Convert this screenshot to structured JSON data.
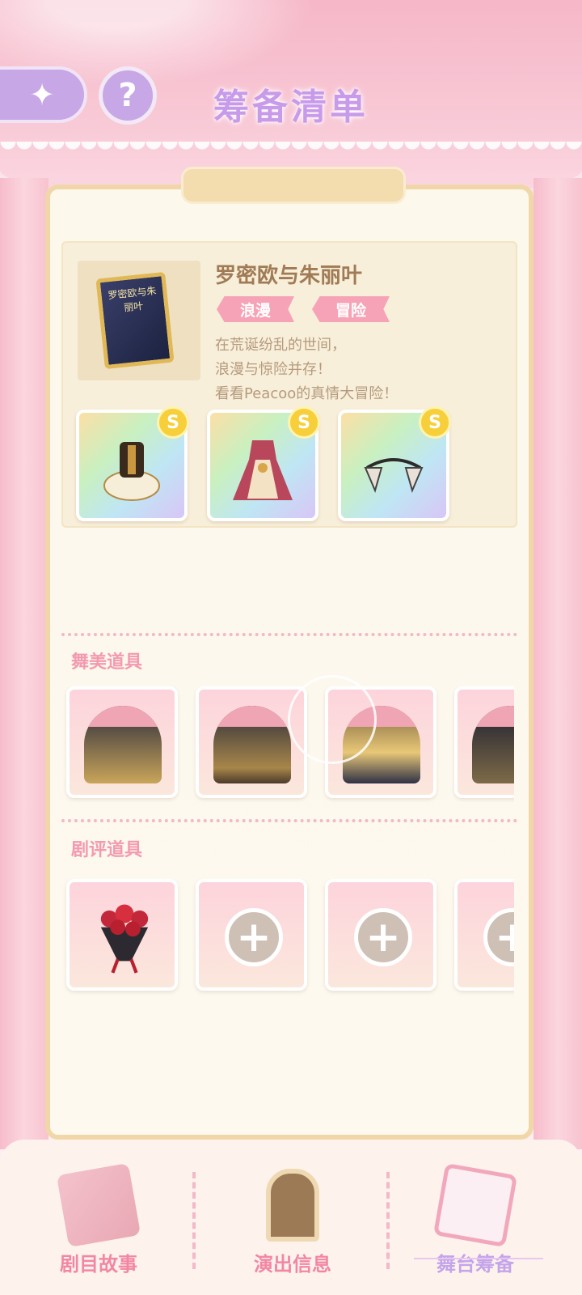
{
  "header": {
    "title": "筹备清单",
    "back_icon": "sparkle-back-icon",
    "help_label": "?"
  },
  "play": {
    "name": "罗密欧与朱丽叶",
    "cover_text": "罗密欧与朱丽叶",
    "tags": [
      "浪漫",
      "冒险"
    ],
    "description": [
      "在荒诞纷乱的世间，",
      "浪漫与惊险并存！",
      "看看Peacoo的真情大冒险！"
    ],
    "outfits": [
      {
        "rank": "S"
      },
      {
        "rank": "S"
      },
      {
        "rank": "S"
      }
    ]
  },
  "sections": {
    "stage_props": {
      "label": "舞美道具"
    },
    "review_props": {
      "label": "剧评道具"
    }
  },
  "bottom_nav": {
    "items": [
      {
        "label": "剧目故事"
      },
      {
        "label": "演出信息"
      },
      {
        "label": "舞台筹备"
      }
    ]
  },
  "plus_label": "+"
}
